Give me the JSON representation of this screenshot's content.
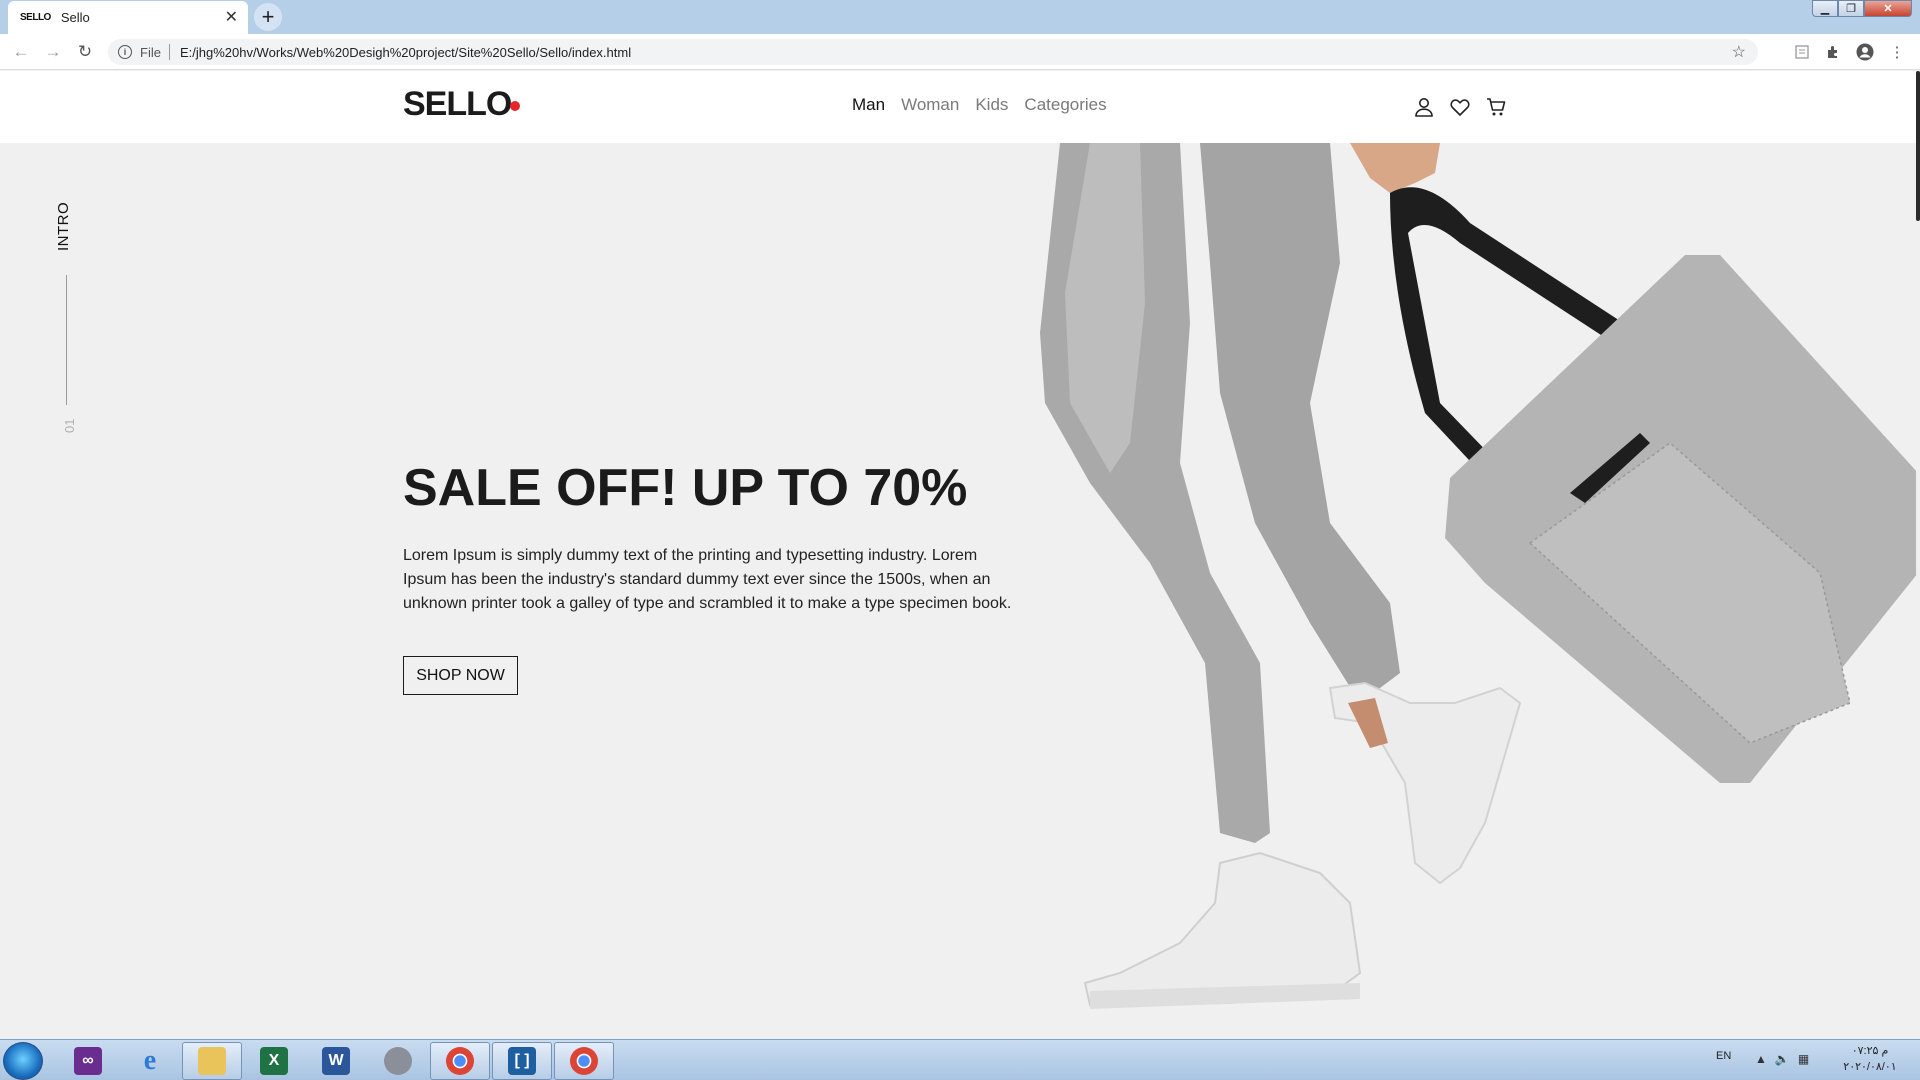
{
  "browser": {
    "tab_title": "Sello",
    "tab_favicon_text": "SELLO",
    "new_tab_label": "+",
    "scheme_label": "File",
    "url": "E:/jhg%20hv/Works/Web%20Desigh%20project/Site%20Sello/Sello/index.html",
    "icons": [
      "back-arrow-icon",
      "forward-arrow-icon",
      "reload-icon",
      "info-icon",
      "star-icon",
      "reader-icon",
      "extensions-icon",
      "profile-icon",
      "menu-icon"
    ]
  },
  "header": {
    "logo": "SELLO",
    "nav": [
      {
        "label": "Man",
        "active": true
      },
      {
        "label": "Woman",
        "active": false
      },
      {
        "label": "Kids",
        "active": false
      },
      {
        "label": "Categories",
        "active": false
      }
    ],
    "icons": [
      "user-icon",
      "heart-icon",
      "cart-icon"
    ]
  },
  "side": {
    "label": "INTRO",
    "number": "01"
  },
  "hero": {
    "title": "SALE OFF! UP TO 70%",
    "text": "Lorem Ipsum is simply dummy text of the printing and typesetting industry. Lorem Ipsum has been the industry's standard dummy text ever since the 1500s, when an unknown printer took a galley of type and scrambled it to make a type specimen book.",
    "button": "SHOP NOW",
    "image_subject": "person in grey sweatpants and white sneakers holding a grey tote bag"
  },
  "colors": {
    "accent": "#e5262b",
    "page_bg": "#f0f0f0",
    "text": "#1b1b1b"
  },
  "taskbar": {
    "apps": [
      "visual-studio-icon",
      "internet-explorer-icon",
      "file-explorer-icon",
      "excel-icon",
      "word-icon",
      "media-icon",
      "chrome-icon",
      "code-editor-icon",
      "chrome-icon"
    ],
    "language": "EN",
    "time": "۰۷:۲۵ م",
    "date": "۲۰۲۰/۰۸/۰۱"
  }
}
